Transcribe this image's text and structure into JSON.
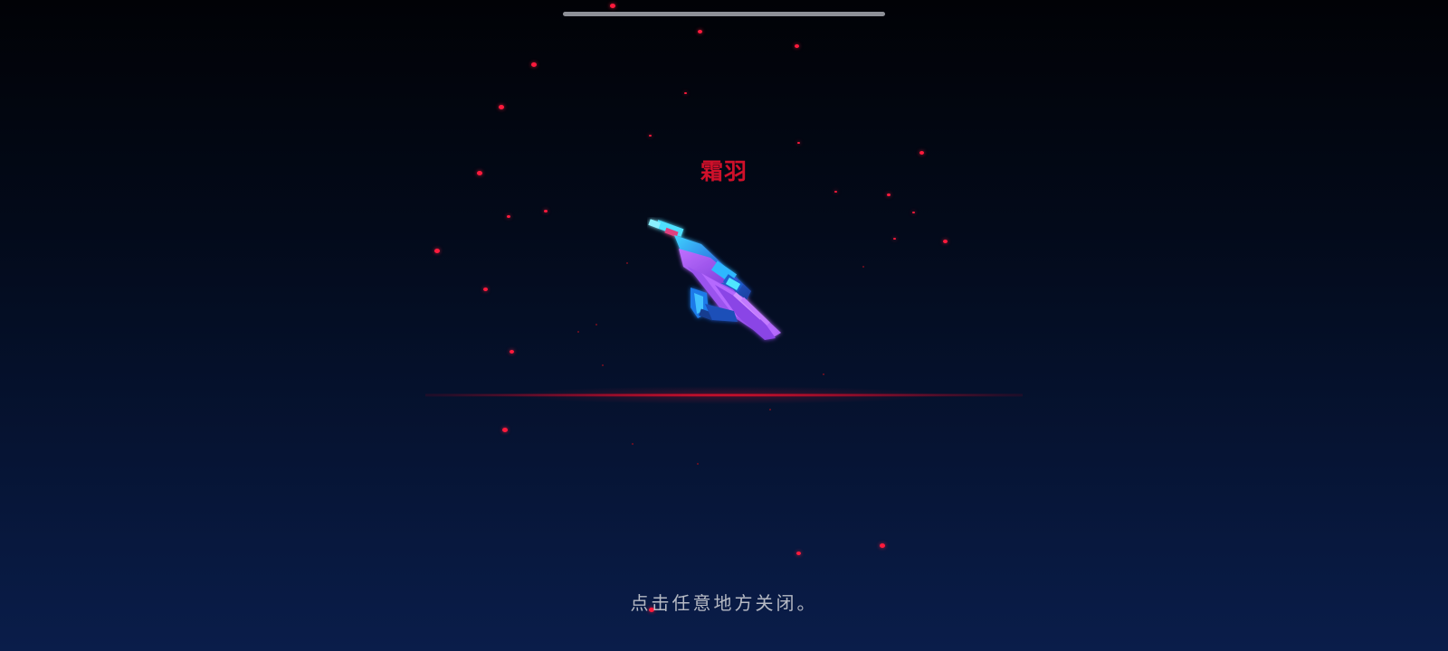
{
  "reward": {
    "item_name": "霜羽",
    "item_icon": "crystal-wing-blaster-icon"
  },
  "hint_text": "点击任意地方关闭。",
  "colors": {
    "accent_red": "#d0102a",
    "background_top": "#010206",
    "background_bottom": "#0a1d4a",
    "hint_text": "#b6bac4"
  }
}
